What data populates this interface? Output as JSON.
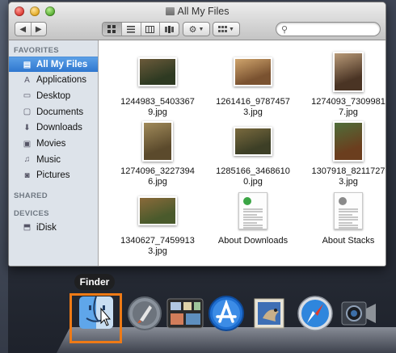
{
  "window": {
    "title": "All My Files",
    "search_placeholder": "",
    "view_buttons": [
      "icon-view",
      "list-view",
      "column-view",
      "coverflow-view"
    ],
    "action_button": "gear-icon",
    "arrange_button": "arrange-icon"
  },
  "sidebar": {
    "favorites_header": "FAVORITES",
    "shared_header": "SHARED",
    "devices_header": "DEVICES",
    "favorites": [
      {
        "label": "All My Files",
        "icon": "all-files-icon",
        "selected": true
      },
      {
        "label": "Applications",
        "icon": "applications-icon"
      },
      {
        "label": "Desktop",
        "icon": "desktop-icon"
      },
      {
        "label": "Documents",
        "icon": "documents-icon"
      },
      {
        "label": "Downloads",
        "icon": "downloads-icon"
      },
      {
        "label": "Movies",
        "icon": "movies-icon"
      },
      {
        "label": "Music",
        "icon": "music-icon"
      },
      {
        "label": "Pictures",
        "icon": "pictures-icon"
      }
    ],
    "devices": [
      {
        "label": "iDisk",
        "icon": "idisk-icon"
      }
    ]
  },
  "files": [
    {
      "name": "1244983_54033679.jpg",
      "line1": "1244983_5403367",
      "line2": "9.jpg",
      "kind": "photo",
      "orient": "land",
      "colors": [
        "#2e3a22",
        "#6b5a3a"
      ]
    },
    {
      "name": "1261416_97874573.jpg",
      "line1": "1261416_9787457",
      "line2": "3.jpg",
      "kind": "photo",
      "orient": "land",
      "colors": [
        "#7a5230",
        "#cfa46c"
      ]
    },
    {
      "name": "1274093_73099817.jpg",
      "line1": "1274093_7309981",
      "line2": "7.jpg",
      "kind": "photo",
      "orient": "port",
      "colors": [
        "#4a3424",
        "#b89a78"
      ]
    },
    {
      "name": "1274096_32273946.jpg",
      "line1": "1274096_3227394",
      "line2": "6.jpg",
      "kind": "photo",
      "orient": "port",
      "colors": [
        "#5b4a2c",
        "#a08a5a"
      ]
    },
    {
      "name": "1285166_34686100.jpg",
      "line1": "1285166_3468610",
      "line2": "0.jpg",
      "kind": "photo",
      "orient": "land",
      "colors": [
        "#3d3f26",
        "#7a6a3e"
      ]
    },
    {
      "name": "1307918_82117273.jpg",
      "line1": "1307918_8211727",
      "line2": "3.jpg",
      "kind": "photo",
      "orient": "port",
      "colors": [
        "#6b3e1e",
        "#4f6e3a"
      ]
    },
    {
      "name": "1340627_74599133.jpg",
      "line1": "1340627_7459913",
      "line2": "3.jpg",
      "kind": "photo",
      "orient": "land",
      "colors": [
        "#4a5a2c",
        "#8a6a3a"
      ]
    },
    {
      "name": "About Downloads",
      "line1": "About Downloads",
      "line2": "",
      "kind": "doc",
      "accent": "#3ba545"
    },
    {
      "name": "About Stacks",
      "line1": "About Stacks",
      "line2": "",
      "kind": "doc",
      "accent": "#8a8a8a"
    }
  ],
  "dock": {
    "tooltip": "Finder",
    "highlight_color": "#ee7a16",
    "apps": [
      {
        "name": "finder-dock-icon"
      },
      {
        "name": "launchpad-dock-icon"
      },
      {
        "name": "mission-control-dock-icon"
      },
      {
        "name": "app-store-dock-icon"
      },
      {
        "name": "mail-dock-icon"
      },
      {
        "name": "safari-dock-icon"
      },
      {
        "name": "facetime-dock-icon"
      }
    ]
  }
}
